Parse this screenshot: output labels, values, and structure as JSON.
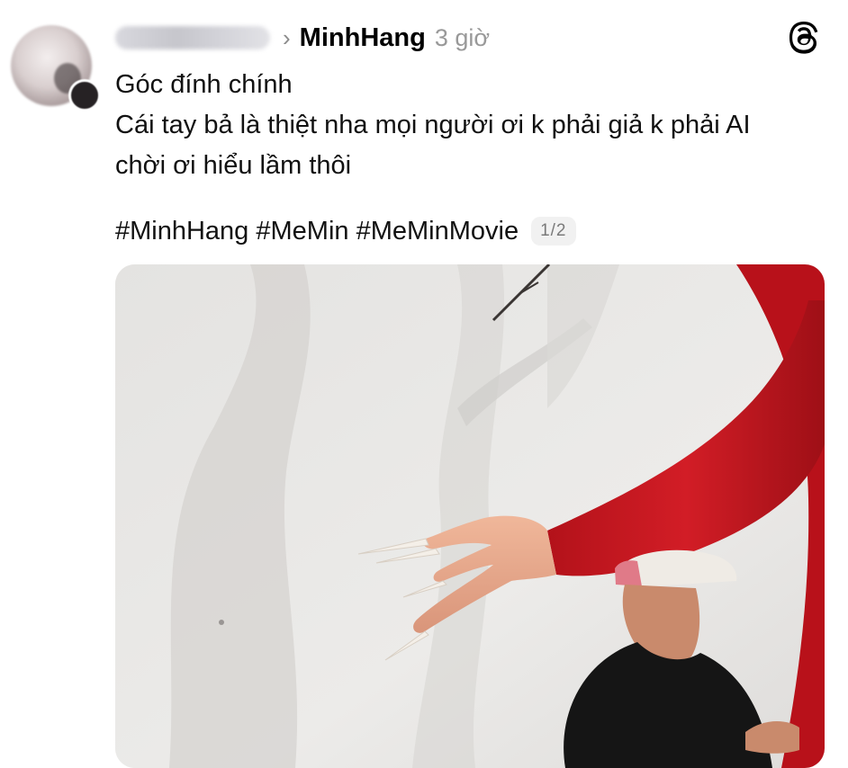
{
  "post": {
    "author_display": "MinhHang",
    "timestamp": "3 giờ",
    "chevron": "›",
    "lines": [
      "Góc đính chính",
      "Cái tay bả là thiệt nha mọi người ơi k phải giả k phải AI",
      "chời ơi hiểu lầm thôi"
    ],
    "hashtags": "#MinhHang #MeMin #MeMinMovie",
    "page_indicator": "1/2"
  },
  "icons": {
    "logo": "threads-logo-icon",
    "avatar": "avatar-image",
    "reposter": "blurred-username"
  },
  "media": {
    "description_colors": {
      "sleeve": "#c0151d",
      "skin": "#e8a98e",
      "shirt": "#151515",
      "cap": "#f0ece6",
      "background": "#e9e8e6"
    }
  }
}
